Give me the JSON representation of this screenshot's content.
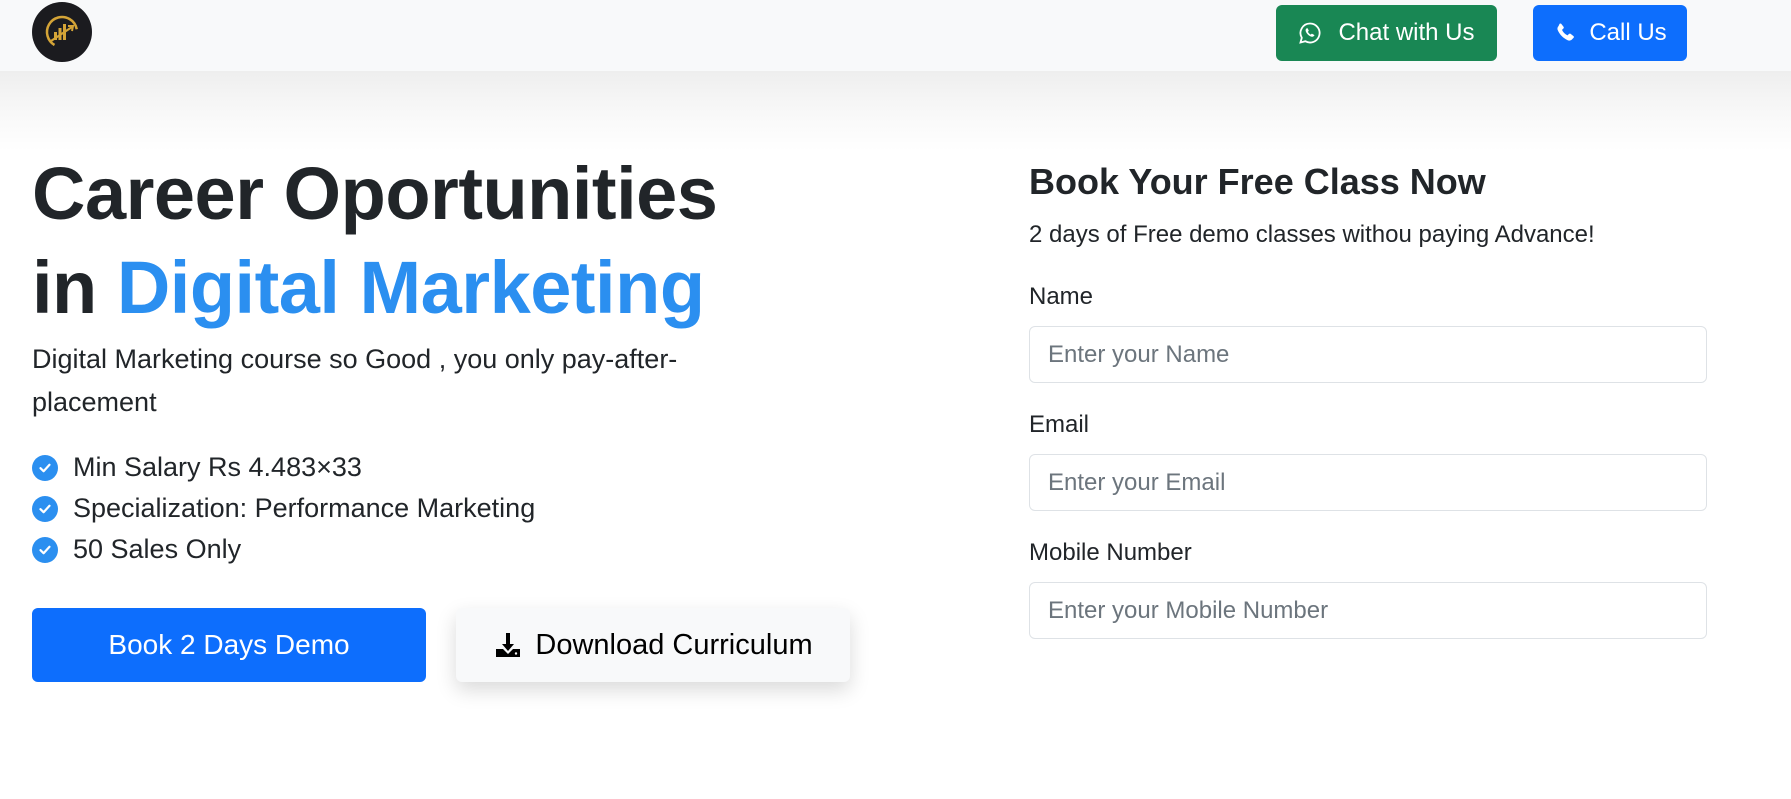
{
  "header": {
    "chat_label": "Chat with Us",
    "call_label": "Call Us",
    "colors": {
      "chat": "#198754",
      "call": "#0d6efd",
      "logo_bg": "#1b1b1f",
      "logo_gold": "#d4a437"
    }
  },
  "hero": {
    "headline_line1": "Career Oportunities",
    "headline_line2_prefix": "in ",
    "headline_line2_accent": "Digital Marketing",
    "accent_color": "#2b8ff0",
    "subtitle": "Digital Marketing course so Good , you only pay-after-placement",
    "features": [
      {
        "icon": "check-circle-icon",
        "text": "Min Salary Rs 4.483×33"
      },
      {
        "icon": "check-circle-icon",
        "text": "Specialization: Performance Marketing"
      },
      {
        "icon": "check-circle-icon",
        "text": "50 Sales Only"
      }
    ],
    "demo_button_label": "Book 2 Days Demo",
    "download_button_label": "Download Curriculum"
  },
  "form": {
    "title": "Book Your Free Class Now",
    "subtitle": "2 days of Free demo classes withou paying Advance!",
    "fields": [
      {
        "label": "Name",
        "placeholder": "Enter your Name",
        "value": ""
      },
      {
        "label": "Email",
        "placeholder": "Enter your Email",
        "value": ""
      },
      {
        "label": "Mobile Number",
        "placeholder": "Enter your Mobile Number",
        "value": ""
      }
    ]
  }
}
